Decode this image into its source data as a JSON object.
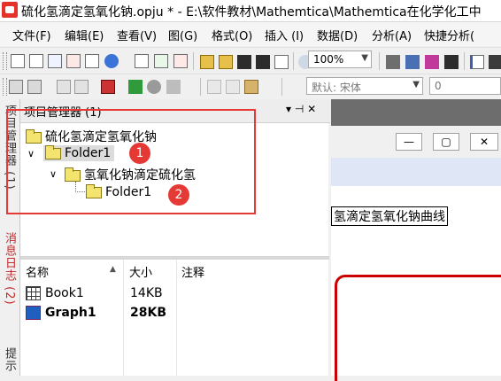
{
  "window": {
    "title": "硫化氢滴定氢氧化钠.opju * - E:\\软件教材\\Mathemtica\\Mathemtica在化学化工中"
  },
  "menu": [
    "文件(F)",
    "编辑(E)",
    "查看(V)",
    "图(G)",
    "格式(O)",
    "插入 (I)",
    "数据(D)",
    "分析(A)",
    "快捷分析("
  ],
  "toolbar": {
    "zoom": "100%",
    "font": "默认: 宋体",
    "font_size": "0",
    "font_icon_label": "Tr"
  },
  "left_tabs": [
    "项目管理器 (1)",
    "消息日志 (2)",
    "提示"
  ],
  "project_manager": {
    "title": "项目管理器 (1)",
    "pin": "▾ ⊣ ✕",
    "tree": {
      "root": "硫化氢滴定氢氧化钠",
      "folder1": "Folder1",
      "subfolder": "氢氧化钠滴定硫化氢",
      "folder1_child": "Folder1"
    },
    "columns": [
      "名称",
      "大小",
      "注释"
    ],
    "sort_arrow": "▲",
    "items": [
      {
        "name": "Book1",
        "size": "14KB",
        "note": ""
      },
      {
        "name": "Graph1",
        "size": "28KB",
        "note": ""
      }
    ]
  },
  "graph": {
    "title_fragment": "氢滴定氢氧化钠曲线"
  },
  "annotations": {
    "badge1": "1",
    "badge2": "2"
  },
  "colors": {
    "annotation_red": "#e53935",
    "folder_yellow": "#f2e46e",
    "graph_red": "#cc0000"
  }
}
